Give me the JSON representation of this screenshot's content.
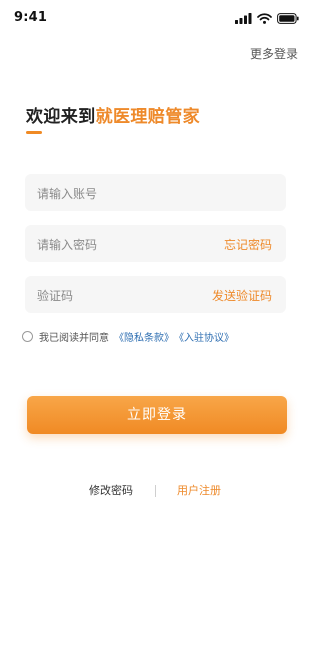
{
  "status_bar": {
    "time": "9:41",
    "icons": [
      "cellular-signal-icon",
      "wifi-icon",
      "battery-icon"
    ]
  },
  "header": {
    "more_login": "更多登录"
  },
  "welcome": {
    "prefix": "欢迎来到",
    "brand": "就医理赔管家"
  },
  "form": {
    "account_placeholder": "请输入账号",
    "password_placeholder": "请输入密码",
    "forgot_password": "忘记密码",
    "code_placeholder": "验证码",
    "send_code": "发送验证码"
  },
  "agreement": {
    "text": "我已阅读并同意",
    "privacy": "《隐私条款》",
    "entry": "《入驻协议》",
    "checked": false
  },
  "login_button": "立即登录",
  "bottom": {
    "change_password": "修改密码",
    "register": "用户注册"
  },
  "colors": {
    "accent": "#ee8a2b",
    "link": "#2f6fb2",
    "field_bg": "#f6f6f6"
  }
}
